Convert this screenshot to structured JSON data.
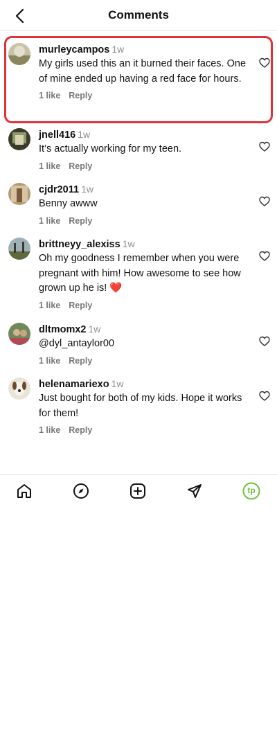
{
  "header": {
    "title": "Comments"
  },
  "comments": [
    {
      "username": "murleycampos",
      "time": "1w",
      "text": "My girls used this an it burned their faces. One of mine ended up having a red face for hours.",
      "likes": "1 like",
      "reply": "Reply"
    },
    {
      "username": "jnell416",
      "time": "1w",
      "text": "It’s actually working for my teen.",
      "likes": "1 like",
      "reply": "Reply"
    },
    {
      "username": "cjdr2011",
      "time": "1w",
      "text": "Benny awww",
      "likes": "1 like",
      "reply": "Reply"
    },
    {
      "username": "brittneyy_alexiss",
      "time": "1w",
      "text": "Oh my goodness I remember when you were pregnant with him! How awesome to see how grown up he is! ❤️",
      "likes": "1 like",
      "reply": "Reply"
    },
    {
      "username": "dltmomx2",
      "time": "1w",
      "text": "@dyl_antaylor00",
      "likes": "1 like",
      "reply": "Reply"
    },
    {
      "username": "helenamariexo",
      "time": "1w",
      "text": "Just bought for both of my kids. Hope it works for them!",
      "likes": "1 like",
      "reply": "Reply"
    }
  ],
  "tabbar": {
    "profile_initials": "tp",
    "profile_color": "#6ac33a"
  },
  "colors": {
    "highlight": "#e0323a",
    "meta": "#777777"
  }
}
